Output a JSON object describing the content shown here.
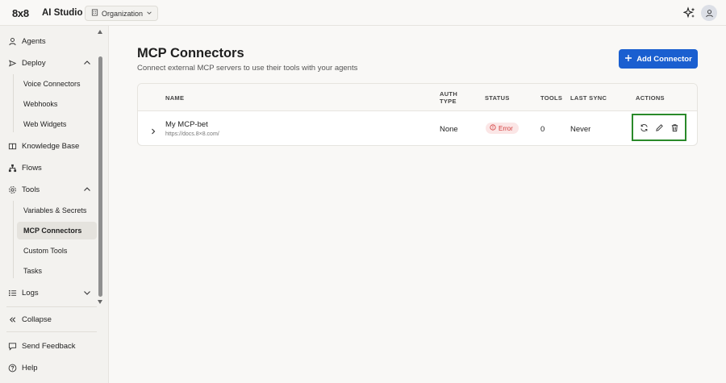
{
  "header": {
    "logo": "8x8",
    "app_name": "AI Studio",
    "org_label": "Organization"
  },
  "sidebar": {
    "items": [
      {
        "label": "Agents",
        "icon": "person-icon"
      },
      {
        "label": "Deploy",
        "icon": "deploy-icon",
        "expanded": true
      },
      {
        "label": "Voice Connectors",
        "sub": true
      },
      {
        "label": "Webhooks",
        "sub": true
      },
      {
        "label": "Web Widgets",
        "sub": true
      },
      {
        "label": "Knowledge Base",
        "icon": "book-icon"
      },
      {
        "label": "Flows",
        "icon": "flows-icon"
      },
      {
        "label": "Tools",
        "icon": "gear-icon",
        "expanded": true
      },
      {
        "label": "Variables & Secrets",
        "sub": true
      },
      {
        "label": "MCP Connectors",
        "sub": true,
        "active": true
      },
      {
        "label": "Custom Tools",
        "sub": true
      },
      {
        "label": "Tasks",
        "sub": true
      },
      {
        "label": "Logs",
        "icon": "logs-icon",
        "expanded": false
      }
    ],
    "collapse_label": "Collapse",
    "feedback_label": "Send Feedback",
    "help_label": "Help"
  },
  "page": {
    "title": "MCP Connectors",
    "subtitle": "Connect external MCP servers to use their tools with your agents",
    "add_button": "Add Connector"
  },
  "table": {
    "columns": {
      "name": "NAME",
      "auth_type": "AUTH TYPE",
      "status": "STATUS",
      "tools": "TOOLS",
      "last_sync": "LAST SYNC",
      "actions": "ACTIONS"
    },
    "rows": [
      {
        "name": "My MCP-bet",
        "url": "https://docs.8×8.com/",
        "auth_type": "None",
        "status": "Error",
        "tools": "0",
        "last_sync": "Never"
      }
    ]
  },
  "colors": {
    "accent": "#1a5fd0",
    "error": "#d23a3a",
    "highlight": "#2a8a2a"
  }
}
